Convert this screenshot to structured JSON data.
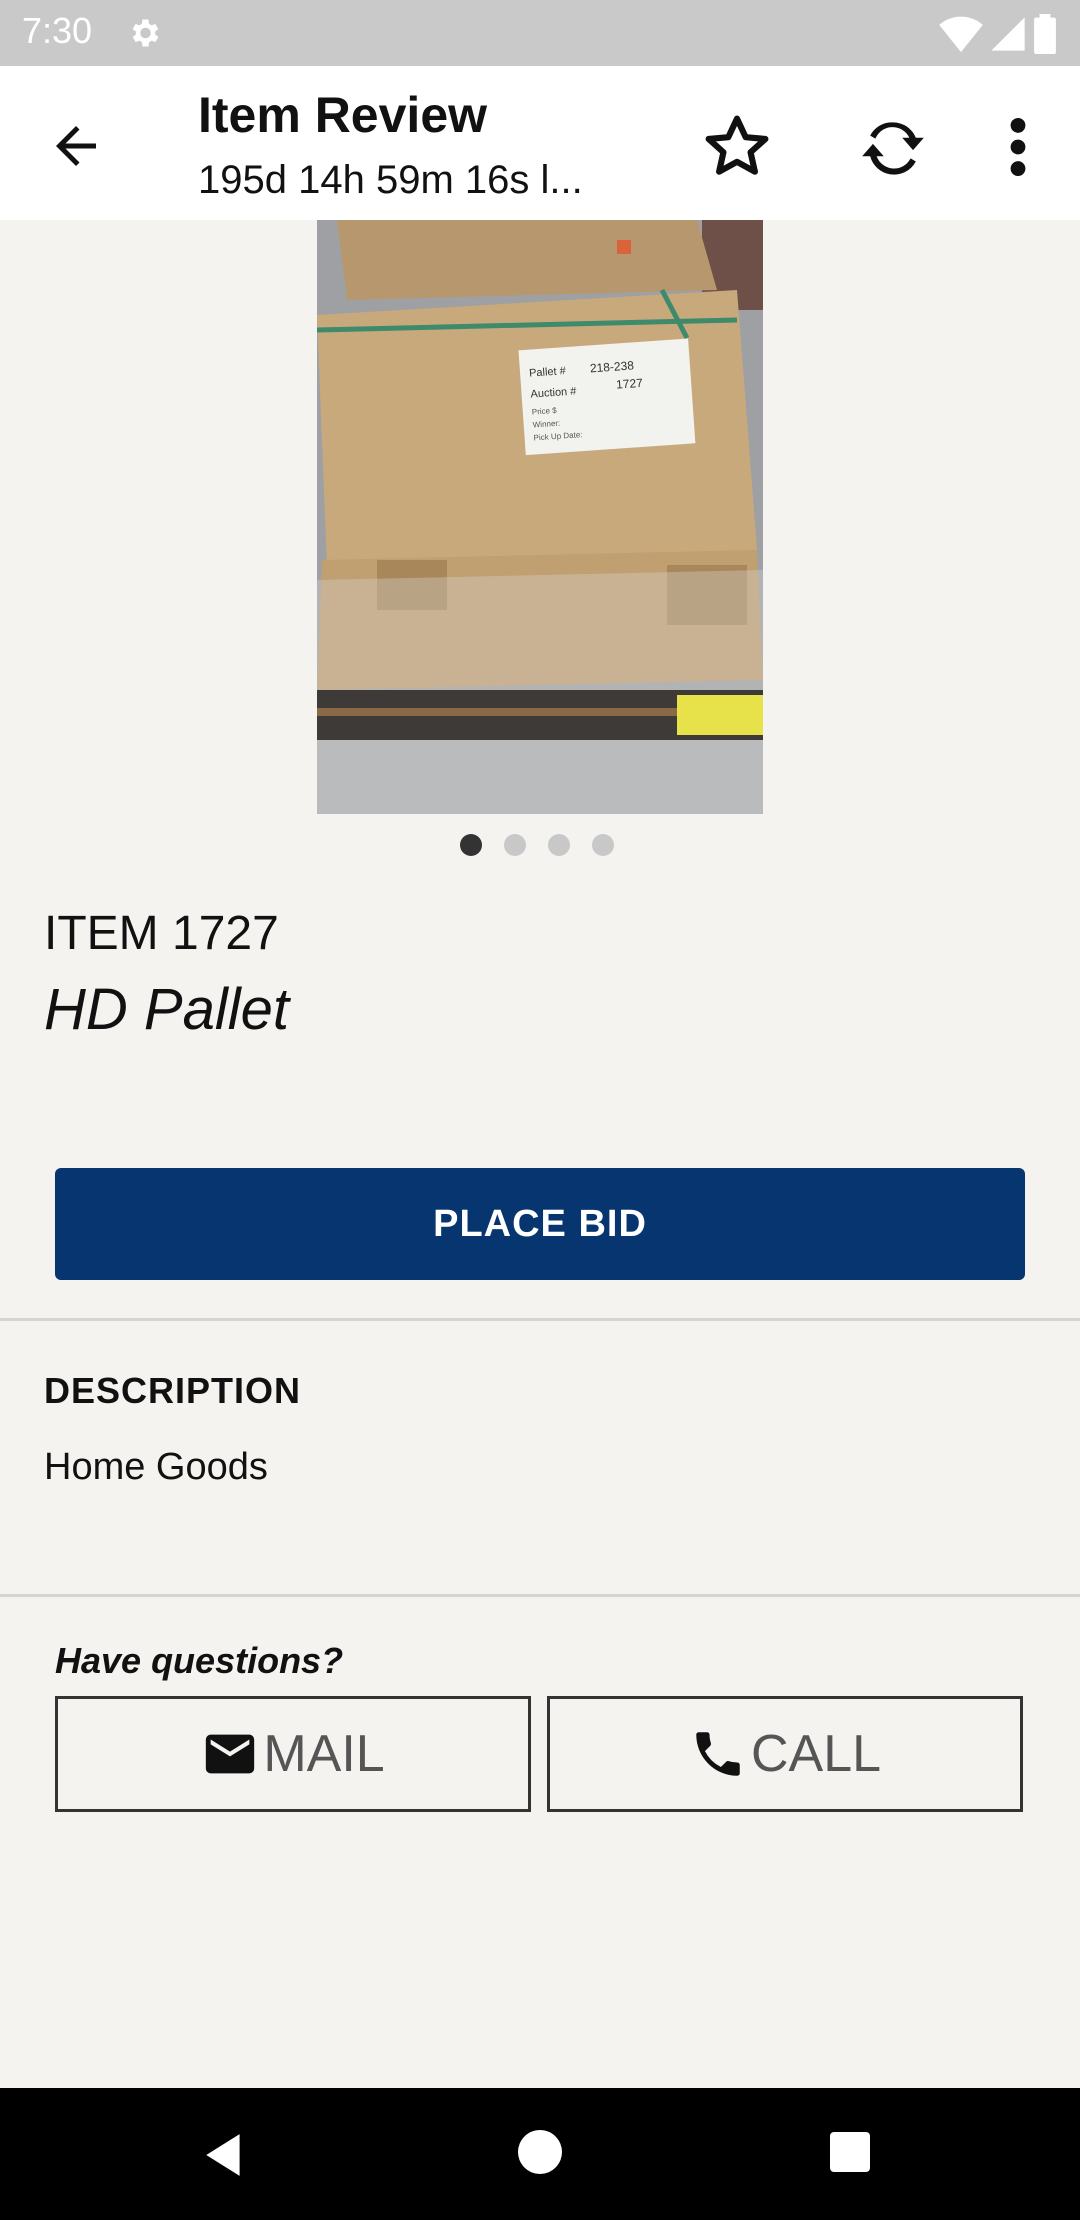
{
  "status_bar": {
    "time": "7:30"
  },
  "app_bar": {
    "title": "Item Review",
    "subtitle": "195d 14h 59m 16s l..."
  },
  "carousel": {
    "page_count": 4,
    "active_index": 0
  },
  "item": {
    "number": "ITEM 1727",
    "name": "HD Pallet"
  },
  "photo_label": {
    "pallet_line": "Pallet #",
    "pallet_value": "218-238",
    "auction_line": "Auction #",
    "auction_value": "1727",
    "price_line": "Price $",
    "winner_line": "Winner:",
    "pickup_line": "Pick Up Date:"
  },
  "actions": {
    "place_bid_label": "PLACE BID"
  },
  "description": {
    "heading": "DESCRIPTION",
    "text": "Home Goods"
  },
  "contact": {
    "prompt": "Have questions?",
    "mail_label": "MAIL",
    "call_label": "CALL"
  },
  "colors": {
    "primary": "#07356f",
    "background": "#f4f3f0",
    "status_bar": "#c9c9c9"
  }
}
